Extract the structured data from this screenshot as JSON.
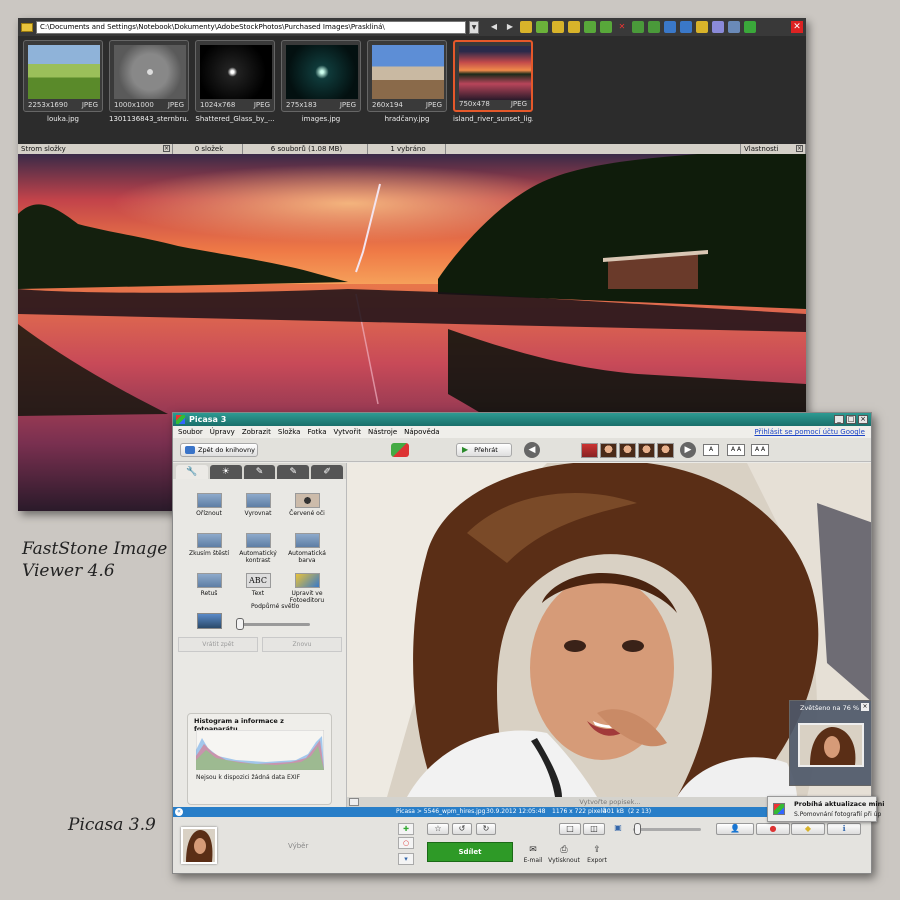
{
  "captions": {
    "faststone": "FastStone Image Viewer 4.6",
    "picasa": "Picasa 3.9"
  },
  "faststone": {
    "path": "C:\\Documents and Settings\\Notebook\\Dokumenty\\AdobeStockPhotos\\Purchased Images\\Praskliná\\",
    "thumbnails": [
      {
        "name": "louka.jpg",
        "dims": "2253x1690",
        "format": "JPEG"
      },
      {
        "name": "1301136843_sternbru...",
        "dims": "1000x1000",
        "format": "JPEG"
      },
      {
        "name": "Shattered_Glass_by_...",
        "dims": "1024x768",
        "format": "JPEG"
      },
      {
        "name": "images.jpg",
        "dims": "275x183",
        "format": "JPEG"
      },
      {
        "name": "hradčany.jpg",
        "dims": "260x194",
        "format": "JPEG"
      },
      {
        "name": "island_river_sunset_lig...",
        "dims": "750x478",
        "format": "JPEG",
        "selected": true
      }
    ],
    "status": {
      "tree": "Strom složky",
      "folders": "0 složek",
      "files": "6 souborů (1.08 MB)",
      "selected": "1 vybráno",
      "properties": "Vlastnosti obrázku"
    }
  },
  "picasa": {
    "title": "Picasa 3",
    "menu": [
      "Soubor",
      "Úpravy",
      "Zobrazit",
      "Složka",
      "Fotka",
      "Vytvořit",
      "Nástroje",
      "Nápověda"
    ],
    "signin": "Přihlásit se pomocí účtu Google",
    "back_label": "Zpět do knihovny",
    "play_label": "Přehrát",
    "size_buttons": [
      "A",
      "A A",
      "A A"
    ],
    "tools": [
      {
        "label": "Oříznout"
      },
      {
        "label": "Vyrovnat"
      },
      {
        "label": "Červené oči"
      },
      {
        "label": "Zkusím štěstí"
      },
      {
        "label": "Automatický kontrast"
      },
      {
        "label": "Automatická barva"
      },
      {
        "label": "Retuš"
      },
      {
        "label": "Text"
      },
      {
        "label": "Upravit ve Fotoeditoru"
      }
    ],
    "fill_light_label": "Podpůrné světlo",
    "fill_light_level": 0,
    "undo_label": "Vrátit zpět",
    "redo_label": "Znovu",
    "histogram_title": "Histogram a informace z fotoaparátu",
    "histogram_note": "Nejsou k dispozici žádná data EXIF",
    "caption_placeholder": "Vytvořte popisek...",
    "zoom_label": "Zvětšeno na 76 %",
    "info": {
      "path": "Picasa > 5546_wpm_hires.jpg",
      "datetime": "30.9.2012 12:05:48",
      "dimensions": "1176 x 722 pixelů",
      "filesize": "401 kB",
      "index": "(2 z 13)"
    },
    "tray_label": "Výběr",
    "share_label": "Sdílet",
    "actions": [
      "E-mail",
      "Vytisknout",
      "Export"
    ],
    "toast_title": "Probíhá aktualizace mini",
    "toast_text": "S.Pomovnání fotografií při úp"
  },
  "colors": {
    "selection": "#e5582a",
    "picasa_title": "#1f7d77",
    "info_bar": "#287ec8",
    "share": "#2e9a27"
  }
}
